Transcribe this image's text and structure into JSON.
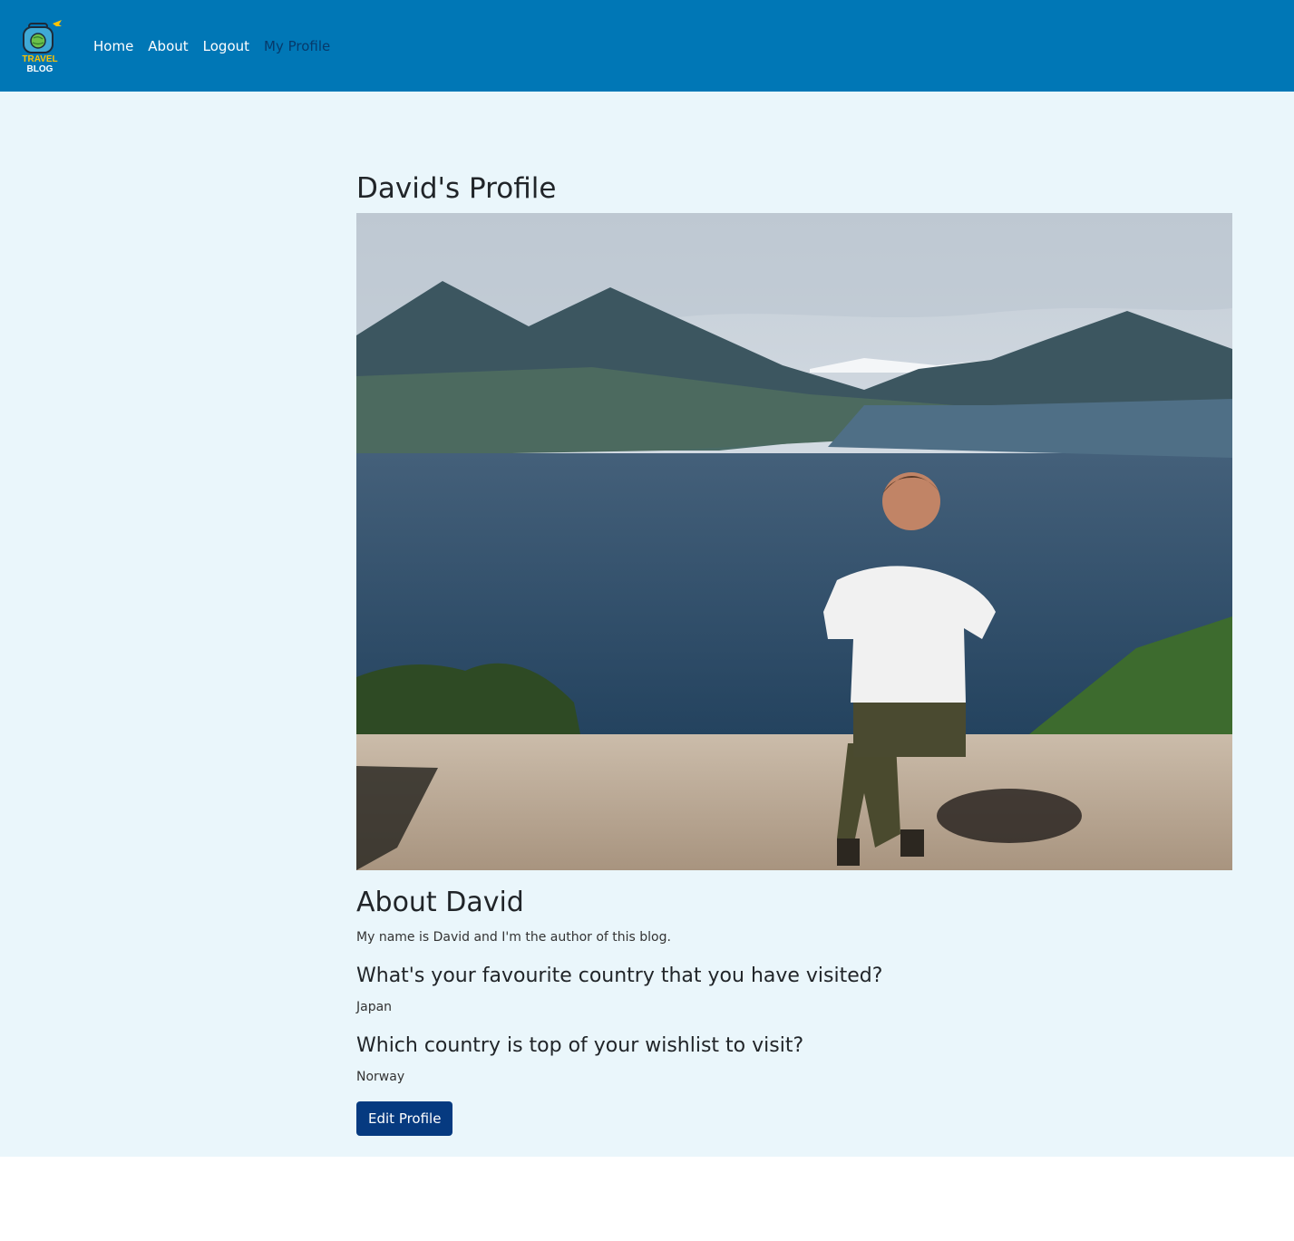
{
  "brand": {
    "logo_line1": "TRAVEL",
    "logo_line2": "BLOG"
  },
  "nav": {
    "items": [
      {
        "label": "Home"
      },
      {
        "label": "About"
      },
      {
        "label": "Logout"
      },
      {
        "label": "My Profile",
        "active": true
      }
    ]
  },
  "profile": {
    "title": "David's Profile",
    "about_heading": "About David",
    "bio": "My name is David and I'm the author of this blog.",
    "q1": "What's your favourite country that you have visited?",
    "a1": "Japan",
    "q2": "Which country is top of your wishlist to visit?",
    "a2": "Norway",
    "edit_button": "Edit Profile"
  },
  "colors": {
    "navbar": "#0077b6",
    "page_bg": "#eaf6fb",
    "button": "#063a80",
    "logo_accent": "#ffc300"
  }
}
